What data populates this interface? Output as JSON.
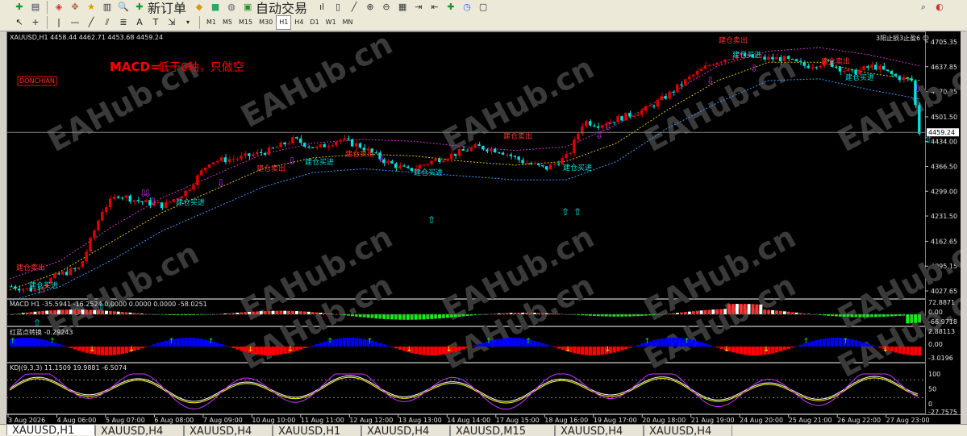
{
  "toolbar": {
    "new_order_label": "新订单",
    "auto_trade_label": "自动交易",
    "timeframes": [
      "M1",
      "M5",
      "M15",
      "M30",
      "H1",
      "H4",
      "D1",
      "W1",
      "MN"
    ],
    "active_timeframe": "H1"
  },
  "chart_header": {
    "symbol_info": "XAUUSD,H1  4458.44 4462.71 4453.68 4459.24",
    "top_right_label": "3阳止损3止盈6 ☺",
    "annotation_macd_bold": "MACD=",
    "annotation_macd_rest": "低于0轴，只做空",
    "donchian_label": "DONCHIAN",
    "watermark": "EAHub.cn",
    "current_price": "4459.24"
  },
  "tabs": [
    "XAUUSD,H1",
    "XAUUSD,H4",
    "XAUUSD,H4",
    "XAUUSD,H1",
    "XAUUSD,H4",
    "XAUUSD,M15",
    "XAUUSD,H4",
    "XAUUSD,H4"
  ],
  "colors": {
    "bull": "#e00000",
    "bear": "#00e0e0",
    "upper": "#cc33cc",
    "middle": "#e0c000",
    "lower": "#3399ff",
    "blue_hist": "#0000ff",
    "red_hist": "#ff0000"
  },
  "chart_data": [
    {
      "type": "candlestick",
      "title": "XAUUSD,H1  4458.44 4462.71 4453.68 4459.24",
      "y_ticks": [
        "4705.35",
        "4637.85",
        "4570.35",
        "4501.50",
        "4434.00",
        "4366.50",
        "4299.00",
        "4231.50",
        "4162.65",
        "4095.15",
        "4027.65"
      ],
      "x_ticks": [
        "3 Aug 2026",
        "4 Aug 06:00",
        "5 Aug 07:00",
        "6 Aug 08:00",
        "7 Aug 09:00",
        "10 Aug 10:00",
        "11 Aug 11:00",
        "12 Aug 12:00",
        "13 Aug 13:00",
        "14 Aug 14:00",
        "17 Aug 15:00",
        "18 Aug 16:00",
        "19 Aug 17:00",
        "20 Aug 18:00",
        "21 Aug 19:00",
        "24 Aug 20:00",
        "25 Aug 21:00",
        "26 Aug 22:00",
        "27 Aug 23:00"
      ],
      "close_path": [
        [
          0,
          4040
        ],
        [
          3,
          4030
        ],
        [
          6,
          4070
        ],
        [
          9,
          4090
        ],
        [
          12,
          4250
        ],
        [
          14,
          4290
        ],
        [
          17,
          4270
        ],
        [
          20,
          4260
        ],
        [
          23,
          4300
        ],
        [
          26,
          4380
        ],
        [
          30,
          4390
        ],
        [
          34,
          4410
        ],
        [
          37,
          4440
        ],
        [
          40,
          4415
        ],
        [
          43,
          4440
        ],
        [
          46,
          4420
        ],
        [
          49,
          4380
        ],
        [
          52,
          4355
        ],
        [
          55,
          4380
        ],
        [
          58,
          4400
        ],
        [
          61,
          4420
        ],
        [
          64,
          4410
        ],
        [
          67,
          4380
        ],
        [
          70,
          4360
        ],
        [
          73,
          4395
        ],
        [
          75,
          4490
        ],
        [
          77,
          4480
        ],
        [
          80,
          4500
        ],
        [
          83,
          4520
        ],
        [
          86,
          4560
        ],
        [
          89,
          4610
        ],
        [
          92,
          4650
        ],
        [
          95,
          4670
        ],
        [
          98,
          4660
        ],
        [
          101,
          4660
        ],
        [
          104,
          4640
        ],
        [
          107,
          4650
        ],
        [
          110,
          4620
        ],
        [
          113,
          4640
        ],
        [
          116,
          4610
        ],
        [
          118,
          4600
        ],
        [
          119,
          4459
        ]
      ],
      "signal_labels": [
        "建仓卖出",
        "建仓买进"
      ],
      "series": [
        {
          "name": "upper",
          "values": [
            4060,
            4110,
            4200,
            4280,
            4340,
            4400,
            4430,
            4440,
            4435,
            4420,
            4410,
            4420,
            4480,
            4560,
            4640,
            4680,
            4690,
            4670,
            4640
          ]
        },
        {
          "name": "middle",
          "values": [
            4030,
            4080,
            4160,
            4240,
            4300,
            4360,
            4390,
            4400,
            4395,
            4380,
            4370,
            4380,
            4430,
            4520,
            4600,
            4650,
            4650,
            4620,
            4600
          ]
        },
        {
          "name": "lower",
          "values": [
            4000,
            4040,
            4110,
            4190,
            4250,
            4310,
            4350,
            4360,
            4350,
            4340,
            4330,
            4330,
            4380,
            4470,
            4540,
            4600,
            4605,
            4575,
            4550
          ]
        }
      ]
    },
    {
      "type": "bar",
      "title": "MACD H1 -35.5941 -16.2524 0.0000 0.0000 0.0000 -58.0251",
      "y_ticks": [
        "72.8871",
        "0.00",
        "-66.9718"
      ]
    },
    {
      "type": "bar",
      "title": "红蓝点转换 -0.29243",
      "y_ticks": [
        "2.88113",
        "0.00",
        "-3.0196"
      ]
    },
    {
      "type": "line",
      "title": "KDJ(9,3,3) 11.1509 19.9881 -6.5074",
      "y_ticks": [
        "100",
        "50",
        "0",
        "-27.7575"
      ],
      "series": [
        {
          "name": "K"
        },
        {
          "name": "D"
        },
        {
          "name": "J"
        }
      ]
    }
  ]
}
